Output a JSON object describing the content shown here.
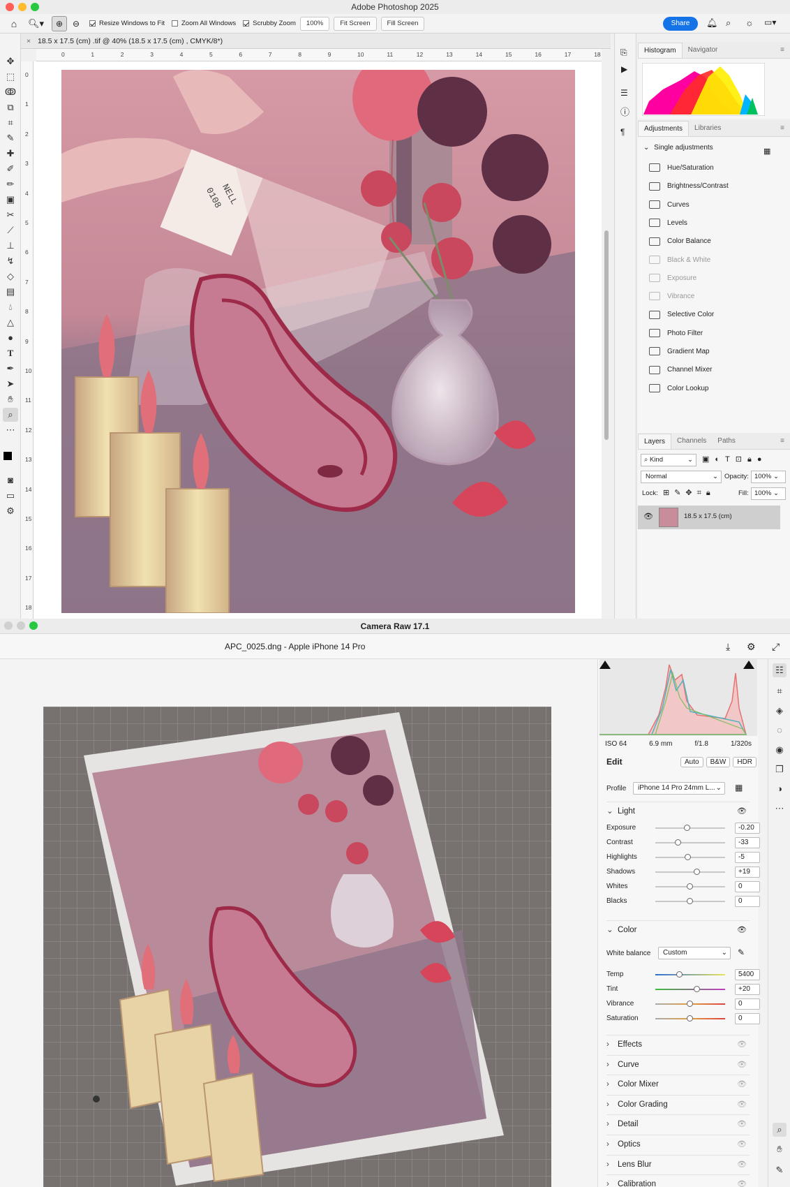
{
  "photoshop": {
    "title": "Adobe Photoshop 2025",
    "options": {
      "resize_windows": "Resize Windows to Fit",
      "zoom_all": "Zoom All Windows",
      "scrubby_zoom": "Scrubby Zoom",
      "zoom_value": "100%",
      "fit_screen": "Fit Screen",
      "fill_screen": "Fill Screen",
      "share": "Share"
    },
    "doc_tab": "18.5 x 17.5 (cm) .tif @ 40% (18.5 x 17.5 (cm) , CMYK/8*)",
    "hruler": [
      "0",
      "1",
      "2",
      "3",
      "4",
      "5",
      "6",
      "7",
      "8",
      "9",
      "10",
      "11",
      "12",
      "13",
      "14",
      "15",
      "16",
      "17",
      "18"
    ],
    "vruler": [
      "0",
      "1",
      "2",
      "3",
      "4",
      "5",
      "6",
      "7",
      "8",
      "9",
      "10",
      "11",
      "12",
      "13",
      "14",
      "15",
      "16",
      "17",
      "18"
    ],
    "histogram_tabs": [
      "Histogram",
      "Navigator"
    ],
    "adjustments_tabs": [
      "Adjustments",
      "Libraries"
    ],
    "single_adjustments": "Single adjustments",
    "adjustments": [
      {
        "label": "Hue/Saturation",
        "dim": false
      },
      {
        "label": "Brightness/Contrast",
        "dim": false
      },
      {
        "label": "Curves",
        "dim": false
      },
      {
        "label": "Levels",
        "dim": false
      },
      {
        "label": "Color Balance",
        "dim": false
      },
      {
        "label": "Black & White",
        "dim": true
      },
      {
        "label": "Exposure",
        "dim": true
      },
      {
        "label": "Vibrance",
        "dim": true
      },
      {
        "label": "Selective Color",
        "dim": false
      },
      {
        "label": "Photo Filter",
        "dim": false
      },
      {
        "label": "Gradient Map",
        "dim": false
      },
      {
        "label": "Channel Mixer",
        "dim": false
      },
      {
        "label": "Color Lookup",
        "dim": false
      }
    ],
    "layers_tabs": [
      "Layers",
      "Channels",
      "Paths"
    ],
    "layers": {
      "kind": "Kind",
      "blend": "Normal",
      "opacity_label": "Opacity:",
      "opacity": "100%",
      "lock_label": "Lock:",
      "fill_label": "Fill:",
      "fill": "100%",
      "layer_name": "18.5 x 17.5 (cm)"
    }
  },
  "camera_raw": {
    "title": "Camera Raw 17.1",
    "file": "APC_0025.dng  -  Apple iPhone 14 Pro",
    "exif": {
      "iso": "ISO 64",
      "focal": "6.9 mm",
      "aperture": "f/1.8",
      "shutter": "1/320s"
    },
    "edit_label": "Edit",
    "buttons": {
      "auto": "Auto",
      "bw": "B&W",
      "hdr": "HDR"
    },
    "profile_label": "Profile",
    "profile": "iPhone 14 Pro 24mm L...",
    "light_label": "Light",
    "light": [
      {
        "label": "Exposure",
        "value": "-0.20",
        "pos": 0.46
      },
      {
        "label": "Contrast",
        "value": "-33",
        "pos": 0.33
      },
      {
        "label": "Highlights",
        "value": "-5",
        "pos": 0.47
      },
      {
        "label": "Shadows",
        "value": "+19",
        "pos": 0.6
      },
      {
        "label": "Whites",
        "value": "0",
        "pos": 0.5
      },
      {
        "label": "Blacks",
        "value": "0",
        "pos": 0.5
      }
    ],
    "color_label": "Color",
    "wb_label": "White balance",
    "wb": "Custom",
    "color": [
      {
        "label": "Temp",
        "value": "5400",
        "pos": 0.35
      },
      {
        "label": "Tint",
        "value": "+20",
        "pos": 0.6
      },
      {
        "label": "Vibrance",
        "value": "0",
        "pos": 0.5
      },
      {
        "label": "Saturation",
        "value": "0",
        "pos": 0.5
      }
    ],
    "sections": [
      "Effects",
      "Curve",
      "Color Mixer",
      "Color Grading",
      "Detail",
      "Optics",
      "Lens Blur",
      "Calibration"
    ]
  },
  "colors": {
    "accent": "#1473e6",
    "slider_track": "#c8c8c8"
  }
}
